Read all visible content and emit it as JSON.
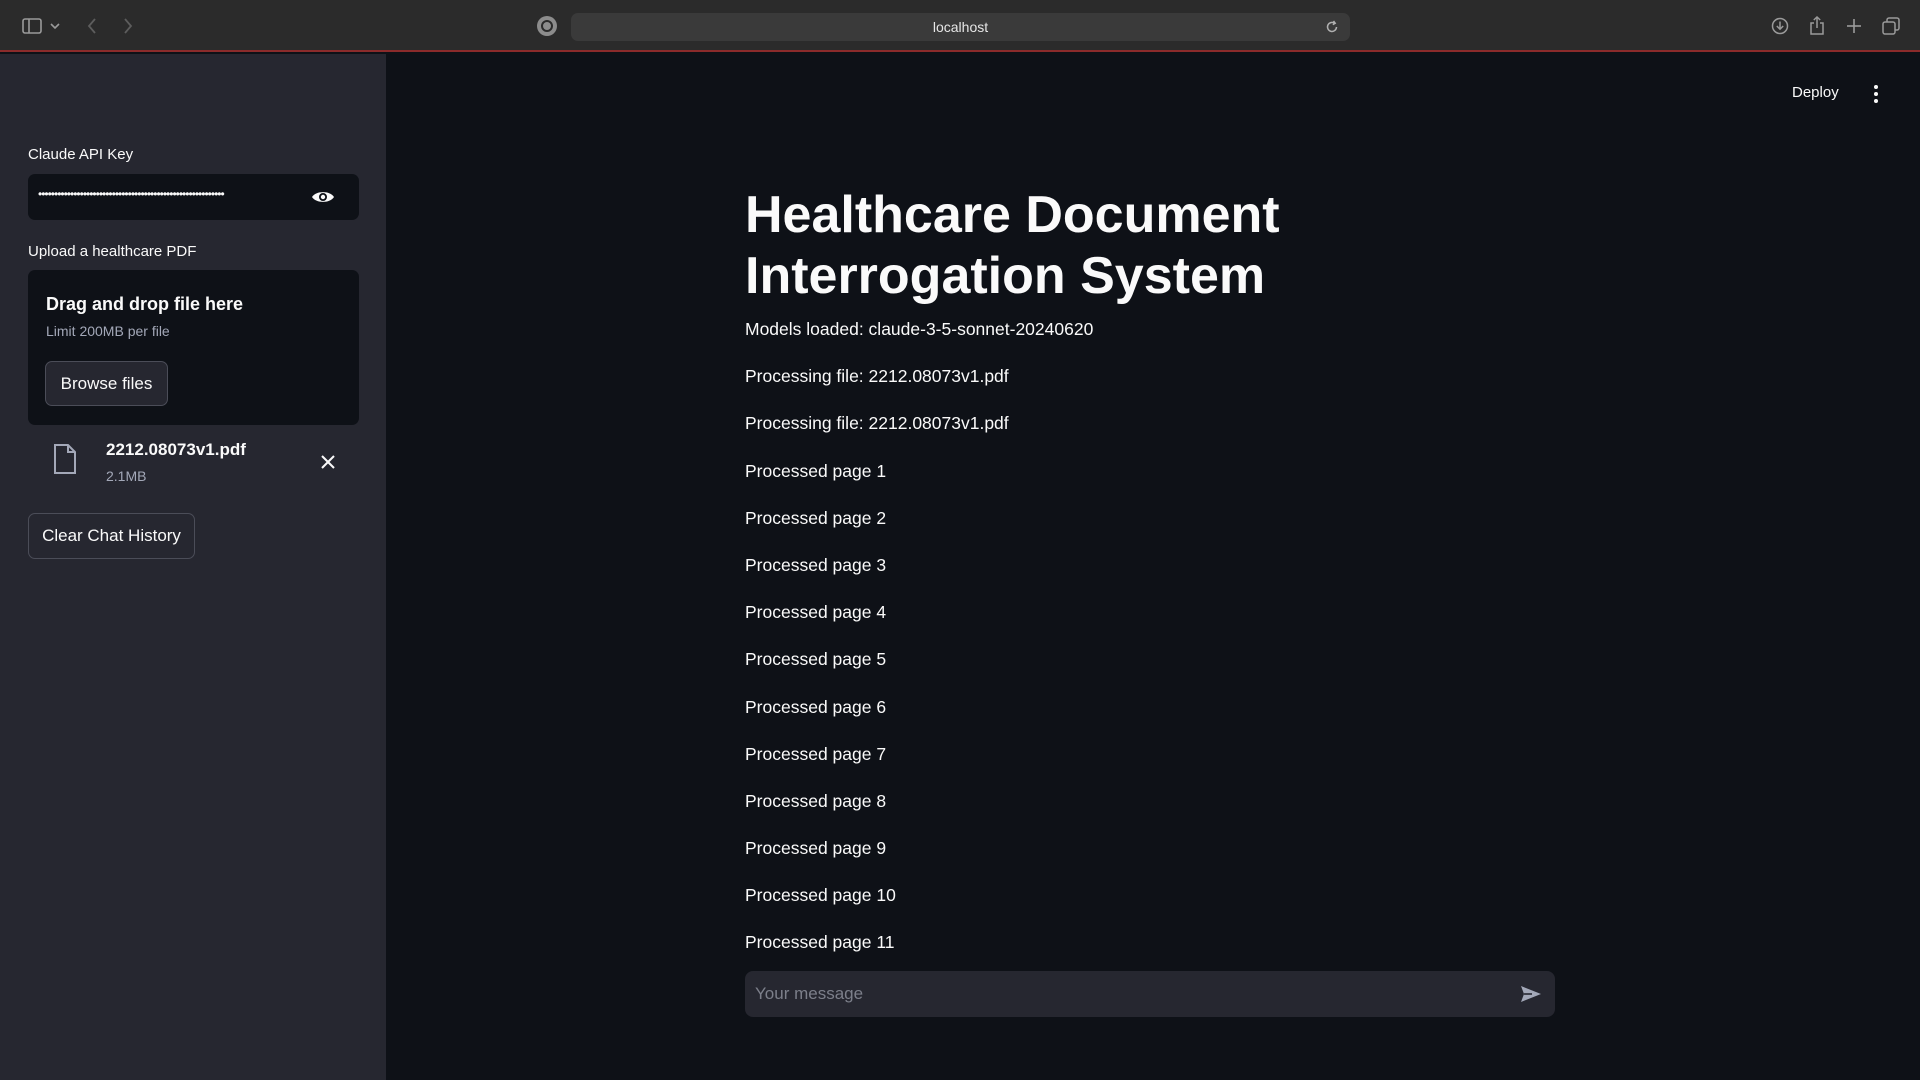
{
  "browser": {
    "url": "localhost"
  },
  "sidebar": {
    "api_key_label": "Claude API Key",
    "api_key_value": "••••••••••••••••••••••••••••••••••••••••••••••••••••••••••",
    "upload_label": "Upload a healthcare PDF",
    "dropzone": {
      "title": "Drag and drop file here",
      "limit": "Limit 200MB per file",
      "browse_label": "Browse files"
    },
    "file": {
      "name": "2212.08073v1.pdf",
      "size": "2.1MB"
    },
    "clear_label": "Clear Chat History"
  },
  "header": {
    "deploy_label": "Deploy"
  },
  "main": {
    "title": "Healthcare Document Interrogation System",
    "log": [
      "Models loaded: claude-3-5-sonnet-20240620",
      "Processing file: 2212.08073v1.pdf",
      "Processing file: 2212.08073v1.pdf",
      "Processed page 1",
      "Processed page 2",
      "Processed page 3",
      "Processed page 4",
      "Processed page 5",
      "Processed page 6",
      "Processed page 7",
      "Processed page 8",
      "Processed page 9",
      "Processed page 10",
      "Processed page 11"
    ],
    "chat_placeholder": "Your message"
  },
  "icons": {
    "sidebar_toggle": "sidebar-icon",
    "back": "chevron-left-icon",
    "forward": "chevron-right-icon",
    "reload": "reload-icon",
    "download": "download-icon",
    "share": "share-icon",
    "new_tab": "plus-icon",
    "tabs": "tabs-icon",
    "password_visibility": "eye-icon",
    "file": "file-icon",
    "remove_file": "close-icon",
    "menu": "kebab-menu-icon",
    "send": "send-icon"
  }
}
